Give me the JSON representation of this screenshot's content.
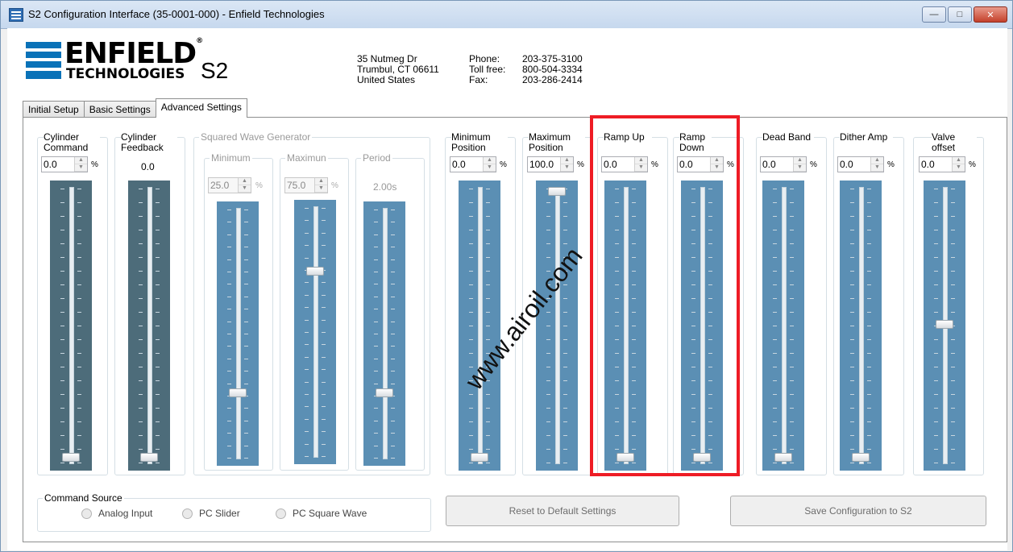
{
  "window": {
    "title": "S2 Configuration Interface (35-0001-000) - Enfield Technologies",
    "buttons": [
      "minimize",
      "maximize",
      "close"
    ]
  },
  "header": {
    "logo_word": "ENFIELD",
    "logo_sub": "TECHNOLOGIES",
    "product": "S2",
    "address": "35 Nutmeg Dr\nTrumbul, CT 06611\nUnited States",
    "contact": [
      {
        "label": "Phone:",
        "value": "203-375-3100"
      },
      {
        "label": "Toll free:",
        "value": "800-504-3334"
      },
      {
        "label": "Fax:",
        "value": "203-286-2414"
      }
    ]
  },
  "tabs": [
    {
      "label": "Initial Setup",
      "active": false
    },
    {
      "label": "Basic Settings",
      "active": false
    },
    {
      "label": "Advanced Settings",
      "active": true
    }
  ],
  "controls": {
    "cyl_cmd": {
      "label": "Cylinder Command",
      "value": "0.0",
      "unit": "%",
      "level": 0.0,
      "enabled": true,
      "track_color": "#4d6c7a"
    },
    "cyl_fb": {
      "label": "Cylinder Feedback",
      "value": "0.0",
      "level": 0.0,
      "track_color": "#4d6c7a"
    },
    "sq_group": {
      "label": "Squared Wave Generator"
    },
    "sq_min": {
      "label": "Minimum",
      "value": "25.0",
      "unit": "%",
      "level": 0.25,
      "enabled": false,
      "track_color": "#5b8fb4"
    },
    "sq_max": {
      "label": "Maximun",
      "value": "75.0",
      "unit": "%",
      "level": 0.75,
      "enabled": false,
      "track_color": "#5b8fb4"
    },
    "sq_period": {
      "label": "Period",
      "value": "2.00s",
      "level": 0.25,
      "track_color": "#5b8fb4"
    },
    "min_pos": {
      "label": "Minimum Position",
      "value": "0.0",
      "unit": "%",
      "level": 0.0,
      "enabled": true,
      "track_color": "#5b8fb4"
    },
    "max_pos": {
      "label": "Maximum Position",
      "value": "100.0",
      "unit": "%",
      "level": 1.0,
      "enabled": true,
      "track_color": "#5b8fb4"
    },
    "ramp_up": {
      "label": "Ramp Up",
      "value": "0.0",
      "unit": "%",
      "level": 0.0,
      "enabled": true,
      "track_color": "#5b8fb4"
    },
    "ramp_down": {
      "label": "Ramp Down",
      "value": "0.0",
      "unit": "%",
      "level": 0.0,
      "enabled": true,
      "track_color": "#5b8fb4"
    },
    "dead_band": {
      "label": "Dead Band",
      "value": "0.0",
      "unit": "%",
      "level": 0.0,
      "enabled": true,
      "track_color": "#5b8fb4"
    },
    "dither_amp": {
      "label": "Dither Amp",
      "value": "0.0",
      "unit": "%",
      "level": 0.0,
      "enabled": true,
      "track_color": "#5b8fb4"
    },
    "valve_offset": {
      "label": "Valve offset",
      "value": "0.0",
      "unit": "%",
      "level": 0.5,
      "enabled": true,
      "track_color": "#5b8fb4"
    }
  },
  "command_source": {
    "label": "Command Source",
    "options": [
      "Analog Input",
      "PC Slider",
      "PC Square Wave"
    ]
  },
  "actions": {
    "reset": "Reset to Default Settings",
    "save": "Save Configuration to S2"
  },
  "highlight_color": "#ee1c25",
  "watermark": "www.airoil.com"
}
